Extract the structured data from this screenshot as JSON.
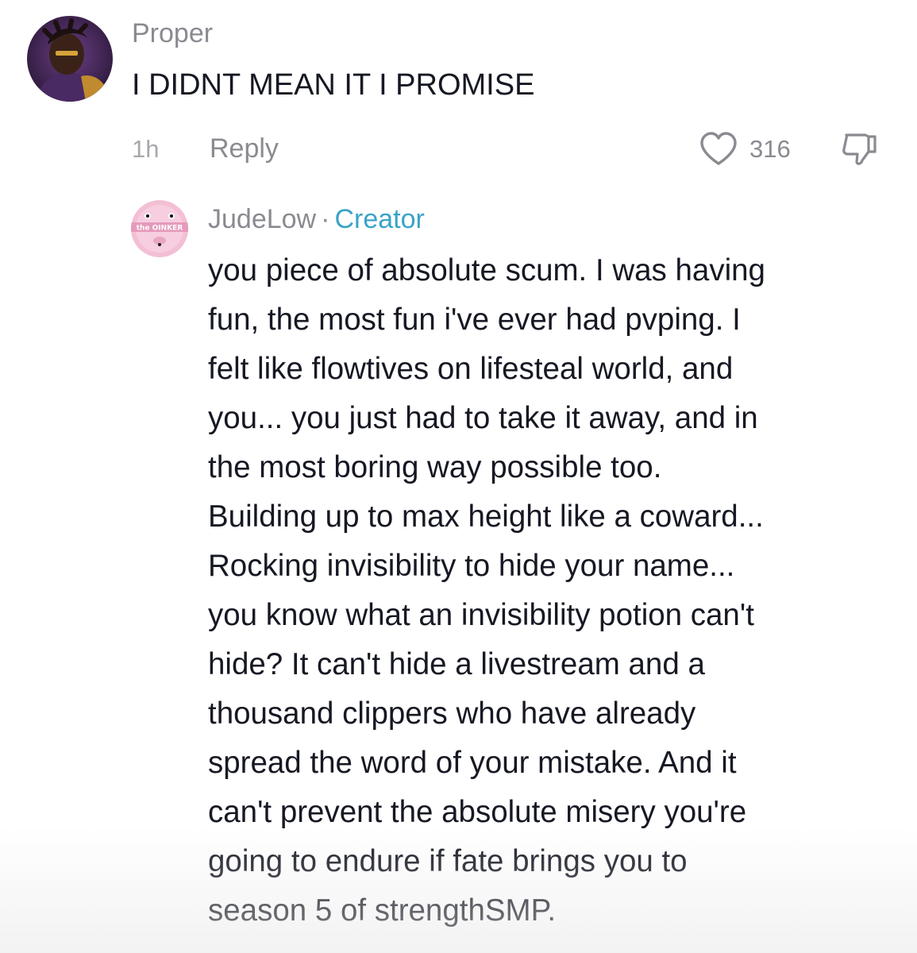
{
  "colors": {
    "username": "#8a8b91",
    "text": "#161823",
    "creator_badge": "#3aa3c8",
    "muted": "#a7a8ad"
  },
  "comment": {
    "username": "Proper",
    "text": "I DIDNT MEAN IT I PROMISE",
    "time": "1h",
    "reply_label": "Reply",
    "like_count": "316",
    "like_icon": "heart-outline-icon",
    "dislike_icon": "thumbs-down-icon"
  },
  "reply": {
    "username": "JudeLow",
    "separator": "·",
    "badge": "Creator",
    "avatar_text": "the OINKER",
    "lines": [
      "you piece of absolute scum. I was having",
      "fun, the most fun i've ever had pvping. I",
      "felt like flowtives on lifesteal world, and",
      "you... you just had to take it away, and in",
      "the most boring way possible too.",
      "Building up to max height like a coward...",
      "Rocking invisibility to hide your name...",
      "you know what an invisibility potion can't",
      "hide? It can't hide a livestream and a",
      "thousand clippers who have already",
      "spread the word of your mistake. And it",
      "can't prevent the absolute misery you're",
      "going to endure if fate brings you to",
      "season 5 of strengthSMP."
    ]
  }
}
